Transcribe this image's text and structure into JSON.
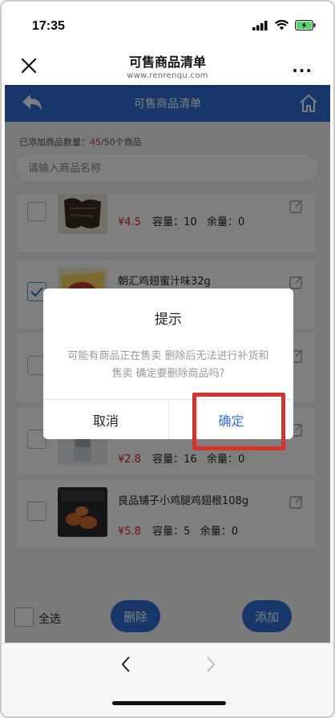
{
  "status": {
    "time": "17:35"
  },
  "browser": {
    "title": "可售商品清单",
    "url": "www.renrenqu.com",
    "more": "..."
  },
  "app": {
    "title": "可售商品清单"
  },
  "summary": {
    "prefix": "已添加商品数量：",
    "count": "45",
    "suffix": "/50个商品"
  },
  "search": {
    "placeholder": "请输入商品名称"
  },
  "items": [
    {
      "name": "",
      "price": "¥4.5",
      "capacity": "容量：10",
      "stock": "余量：0",
      "checked": false
    },
    {
      "name": "朝汇鸡翅蜜汁味32g",
      "price": "",
      "capacity": "",
      "stock": "",
      "checked": true
    },
    {
      "name": "",
      "price": "",
      "capacity": "",
      "stock": "",
      "checked": false
    },
    {
      "name": "",
      "price": "¥2.8",
      "capacity": "容量：16",
      "stock": "余量：0",
      "checked": false
    },
    {
      "name": "良品铺子小鸡腿鸡翅根108g",
      "price": "¥5.8",
      "capacity": "容量：5",
      "stock": "余量：0",
      "checked": false
    }
  ],
  "bottom": {
    "select_all": "全选",
    "delete": "删除",
    "add": "添加"
  },
  "dialog": {
    "title": "提示",
    "message": "可能有商品正在售卖 删除后无法进行补货和售卖 确定要删除商品吗?",
    "cancel": "取消",
    "confirm": "确定"
  },
  "colors": {
    "primary": "#2f6fd5",
    "price": "#e0201c",
    "highlight": "#d8322a"
  }
}
